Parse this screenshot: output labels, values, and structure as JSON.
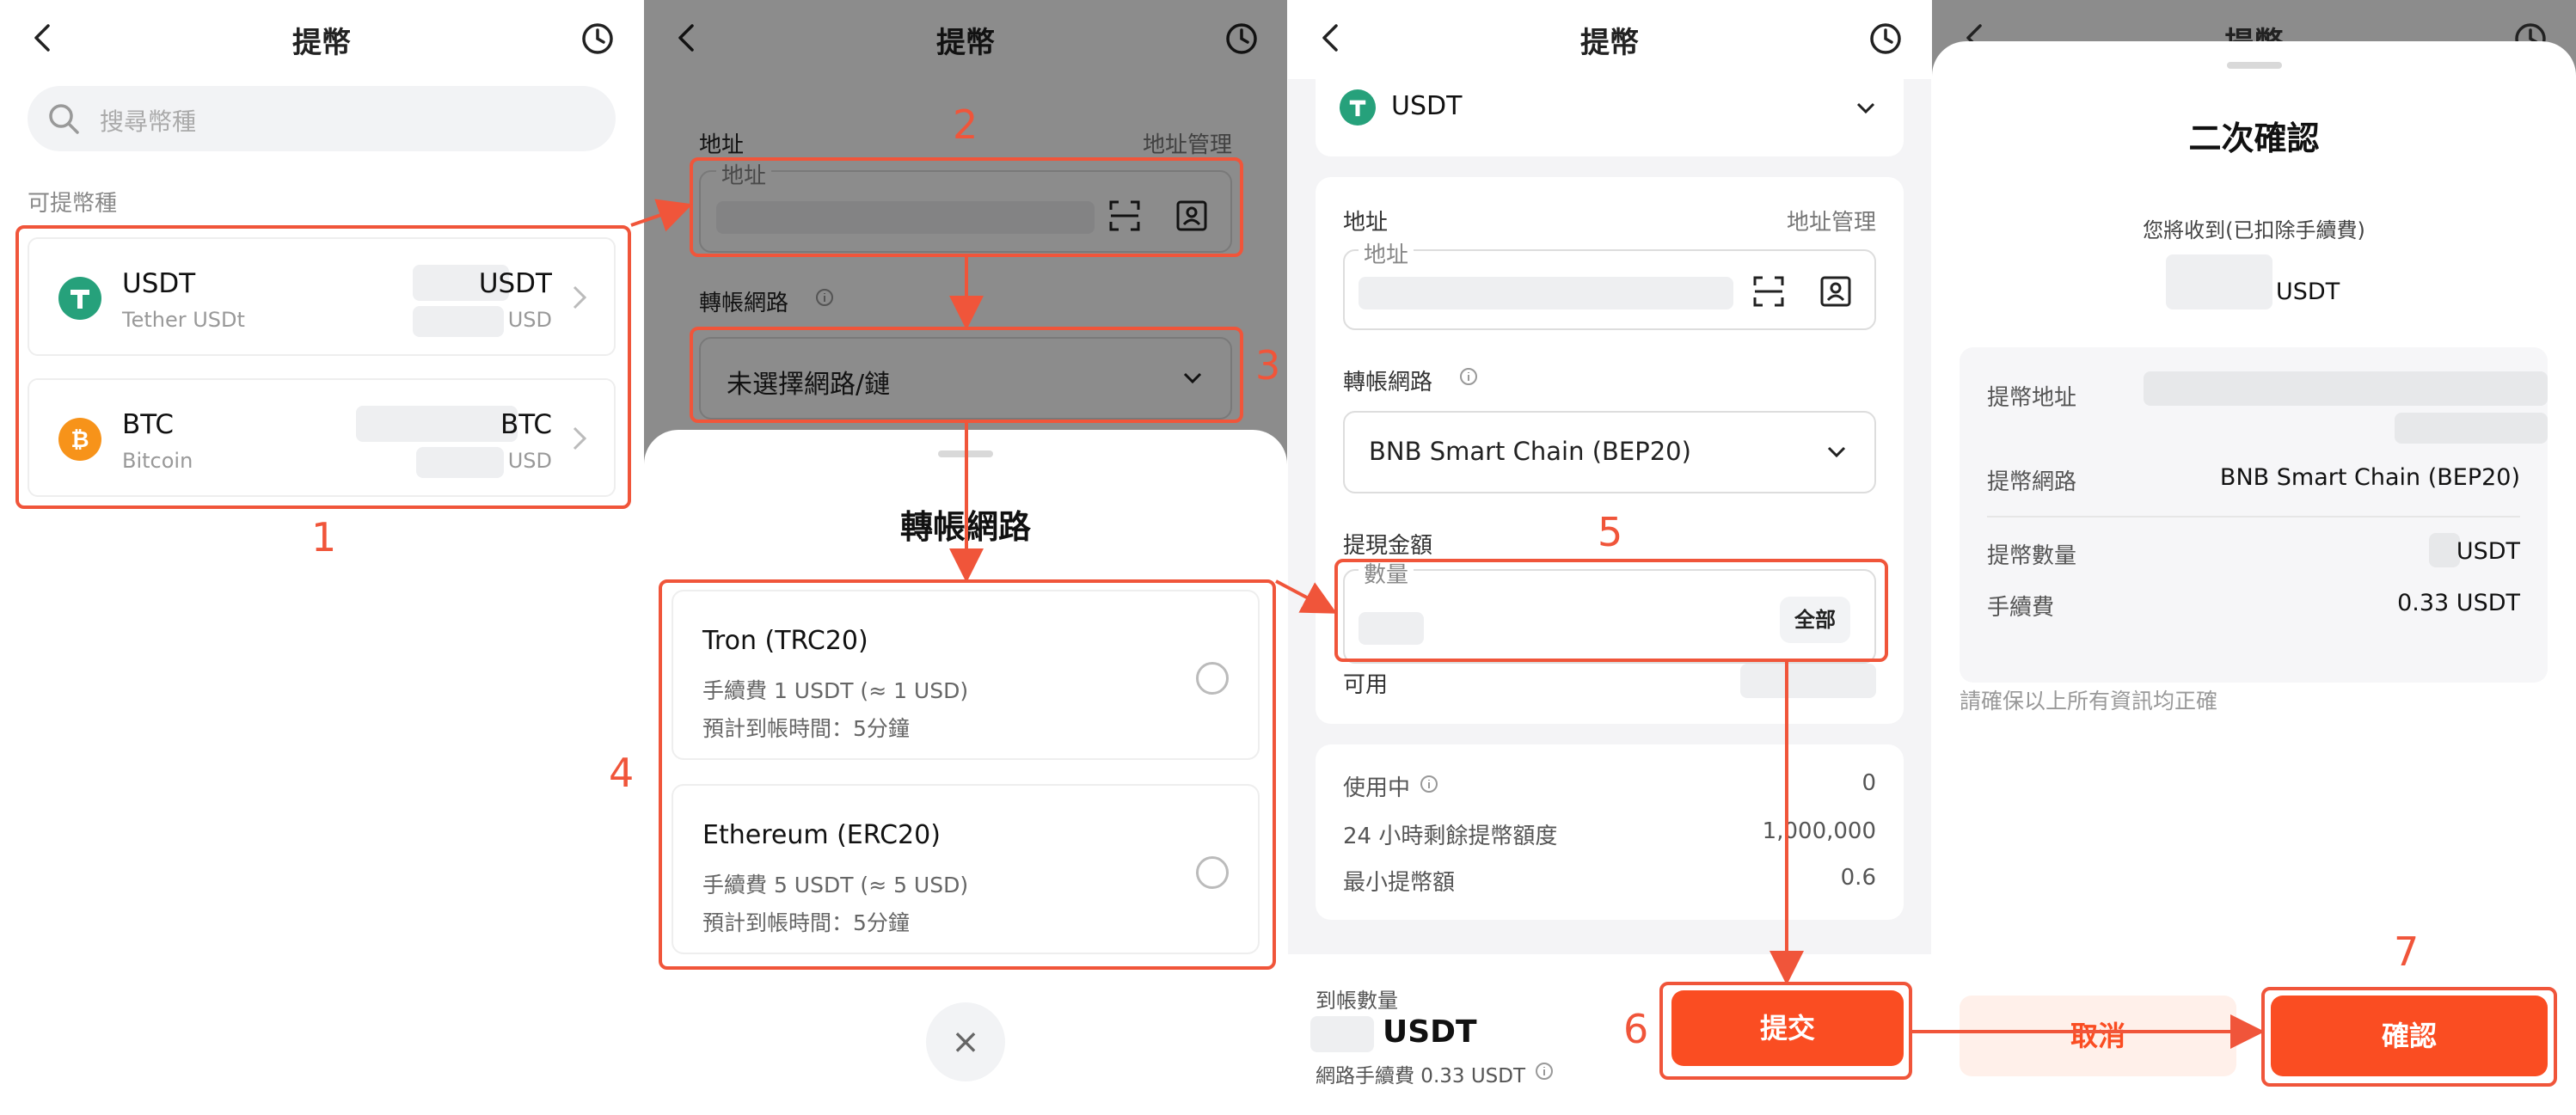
{
  "colors": {
    "accent": "#fa4d22",
    "annotation": "#f0553a",
    "usdt": "#26a17b",
    "btc": "#f7931a"
  },
  "header": {
    "title": "提幣"
  },
  "panel1": {
    "search_placeholder": "搜尋幣種",
    "section_label": "可提幣種",
    "coins": [
      {
        "symbol": "USDT",
        "name": "Tether USDt",
        "amount_unit": "USDT",
        "usd_unit": "USD",
        "icon": "usdt-icon"
      },
      {
        "symbol": "BTC",
        "name": "Bitcoin",
        "amount_unit": "BTC",
        "usd_unit": "USD",
        "icon": "btc-icon"
      }
    ]
  },
  "panel2": {
    "address_label": "地址",
    "address_manage": "地址管理",
    "address_legend": "地址",
    "network_label": "轉帳網路",
    "network_placeholder": "未選擇網路/鏈",
    "sheet_title": "轉帳網路",
    "options": [
      {
        "name": "Tron (TRC20)",
        "fee": "手續費 1 USDT (≈ 1 USD)",
        "time": "預計到帳時間：5分鐘"
      },
      {
        "name": "Ethereum (ERC20)",
        "fee": "手續費 5 USDT (≈ 5 USD)",
        "time": "預計到帳時間：5分鐘"
      }
    ],
    "close": "×"
  },
  "panel3": {
    "coin": "USDT",
    "address_label": "地址",
    "address_manage": "地址管理",
    "address_legend": "地址",
    "network_label": "轉帳網路",
    "network_value": "BNB Smart Chain (BEP20)",
    "amount_label": "提現金額",
    "amount_legend": "數量",
    "all_button": "全部",
    "available_label": "可用",
    "stats": [
      {
        "label": "使用中",
        "value": "0"
      },
      {
        "label": "24 小時剩餘提幣額度",
        "value": "1,000,000"
      },
      {
        "label": "最小提幣額",
        "value": "0.6"
      }
    ],
    "receive_label": "到帳數量",
    "receive_unit": "USDT",
    "network_fee": "網路手續費 0.33 USDT",
    "submit": "提交"
  },
  "panel4": {
    "title": "二次確認",
    "subtitle": "您將收到(已扣除手續費)",
    "unit": "USDT",
    "address_label": "提幣地址",
    "network_label": "提幣網路",
    "network_value": "BNB Smart Chain (BEP20)",
    "qty_label": "提幣數量",
    "qty_unit": "USDT",
    "fee_label": "手續費",
    "fee_value": "0.33 USDT",
    "notice": "請確保以上所有資訊均正確",
    "cancel": "取消",
    "confirm": "確認"
  },
  "annotations": [
    "1",
    "2",
    "3",
    "4",
    "5",
    "6",
    "7"
  ]
}
